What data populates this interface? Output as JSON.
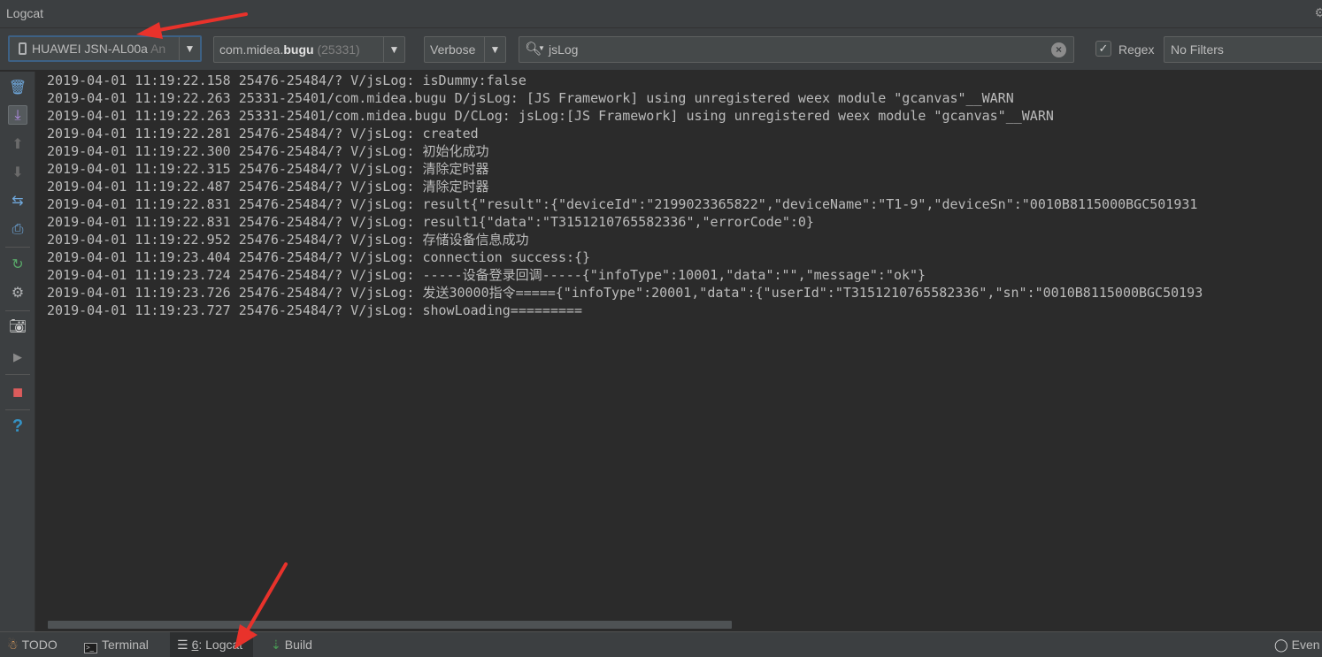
{
  "window": {
    "title": "Logcat"
  },
  "toolbar": {
    "device": {
      "name": "HUAWEI JSN-AL00a",
      "suffix": "An"
    },
    "process": {
      "package_prefix": "com.midea.",
      "package_bold": "bugu",
      "pid": "(25331)"
    },
    "log_level": "Verbose",
    "search": {
      "query": "jsLog"
    },
    "regex": {
      "label": "Regex",
      "checked": true
    },
    "filter": "No Filters"
  },
  "left_tools": [
    {
      "name": "clear-logcat-icon",
      "glyph": "🗑"
    },
    {
      "name": "scroll-to-end-icon",
      "glyph": "⤓"
    },
    {
      "name": "up-arrow-icon",
      "glyph": "⬆"
    },
    {
      "name": "down-arrow-icon",
      "glyph": "⬇"
    },
    {
      "name": "soft-wraps-icon",
      "glyph": "⇆"
    },
    {
      "name": "print-icon",
      "glyph": "⎙"
    },
    {
      "name": "restart-icon",
      "glyph": "↻"
    },
    {
      "name": "settings-icon",
      "glyph": "⚙"
    },
    {
      "name": "screen-capture-icon",
      "glyph": "📷"
    },
    {
      "name": "screen-record-icon",
      "glyph": "▶"
    },
    {
      "name": "stop-icon",
      "glyph": "■"
    },
    {
      "name": "help-icon",
      "glyph": "?"
    }
  ],
  "log_lines": [
    "2019-04-01 11:19:22.158 25476-25484/? V/jsLog: isDummy:false",
    "2019-04-01 11:19:22.263 25331-25401/com.midea.bugu D/jsLog: [JS Framework] using unregistered weex module \"gcanvas\"__WARN",
    "2019-04-01 11:19:22.263 25331-25401/com.midea.bugu D/CLog: jsLog:[JS Framework] using unregistered weex module \"gcanvas\"__WARN",
    "2019-04-01 11:19:22.281 25476-25484/? V/jsLog: created",
    "2019-04-01 11:19:22.300 25476-25484/? V/jsLog: 初始化成功",
    "2019-04-01 11:19:22.315 25476-25484/? V/jsLog: 清除定时器",
    "2019-04-01 11:19:22.487 25476-25484/? V/jsLog: 清除定时器",
    "2019-04-01 11:19:22.831 25476-25484/? V/jsLog: result{\"result\":{\"deviceId\":\"2199023365822\",\"deviceName\":\"T1-9\",\"deviceSn\":\"0010B8115000BGC501931",
    "2019-04-01 11:19:22.831 25476-25484/? V/jsLog: result1{\"data\":\"T3151210765582336\",\"errorCode\":0}",
    "2019-04-01 11:19:22.952 25476-25484/? V/jsLog: 存储设备信息成功",
    "2019-04-01 11:19:23.404 25476-25484/? V/jsLog: connection success:{}",
    "2019-04-01 11:19:23.724 25476-25484/? V/jsLog: -----设备登录回调-----{\"infoType\":10001,\"data\":\"\",\"message\":\"ok\"}",
    "2019-04-01 11:19:23.726 25476-25484/? V/jsLog: 发送30000指令====={\"infoType\":20001,\"data\":{\"userId\":\"T3151210765582336\",\"sn\":\"0010B8115000BGC50193",
    "2019-04-01 11:19:23.727 25476-25484/? V/jsLog: showLoading========="
  ],
  "bottom_tabs": [
    {
      "name": "tab-todo",
      "label": "TODO"
    },
    {
      "name": "tab-terminal",
      "label": "Terminal"
    },
    {
      "name": "tab-logcat",
      "number": "6",
      "label": ": Logcat"
    },
    {
      "name": "tab-build",
      "label": "Build"
    },
    {
      "name": "tab-event-log",
      "label": "Even"
    }
  ],
  "colors": {
    "accent_arrow": "#e8322b",
    "focus_border": "#3d6185",
    "panel": "#3c3f41",
    "editor": "#2b2b2b"
  }
}
